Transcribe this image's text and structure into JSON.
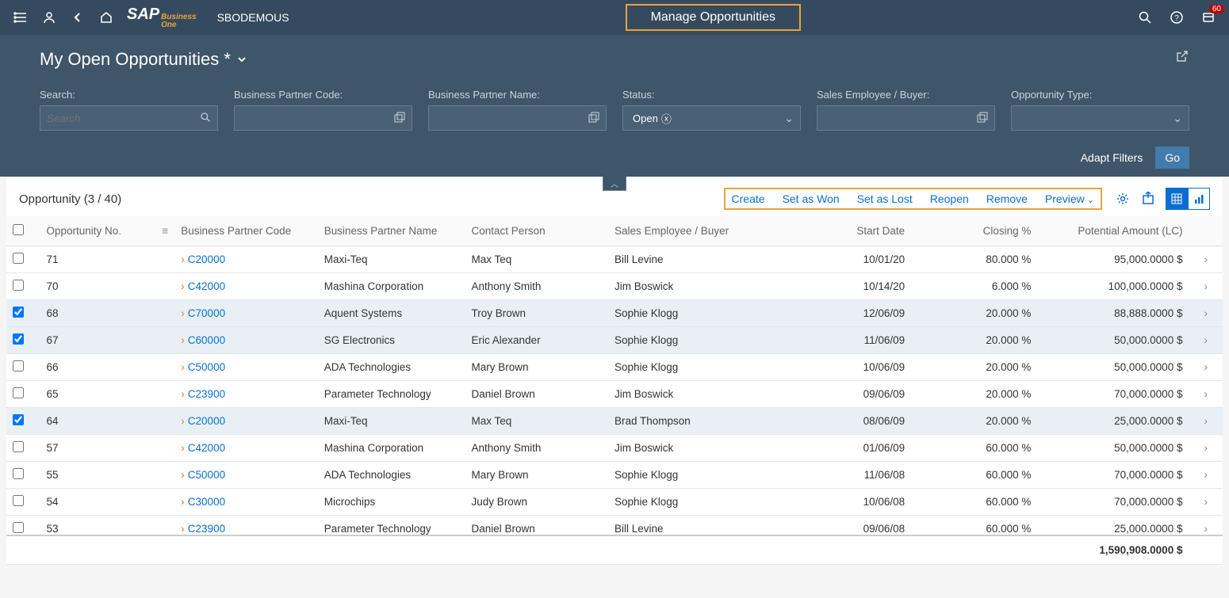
{
  "shell": {
    "tenant": "SBODEMOUS",
    "title": "Manage Opportunities",
    "notification_count": "60",
    "logo_main": "SAP",
    "logo_sub1": "Business",
    "logo_sub2": "One"
  },
  "page": {
    "view_title": "My Open Opportunities *",
    "share_glyph": "⇱"
  },
  "filters": {
    "search": {
      "label": "Search:",
      "placeholder": "Search"
    },
    "bp_code": {
      "label": "Business Partner Code:"
    },
    "bp_name": {
      "label": "Business Partner Name:"
    },
    "status": {
      "label": "Status:",
      "value": "Open"
    },
    "sales_emp": {
      "label": "Sales Employee / Buyer:"
    },
    "opp_type": {
      "label": "Opportunity Type:"
    },
    "adapt": "Adapt Filters",
    "go": "Go"
  },
  "table": {
    "title": "Opportunity (3 / 40)",
    "actions": {
      "create": "Create",
      "won": "Set as Won",
      "lost": "Set as Lost",
      "reopen": "Reopen",
      "remove": "Remove",
      "preview": "Preview"
    },
    "columns": {
      "opp_no": "Opportunity No.",
      "bp_code": "Business Partner Code",
      "bp_name": "Business Partner Name",
      "contact": "Contact Person",
      "sales_emp": "Sales Employee / Buyer",
      "start_date": "Start Date",
      "closing": "Closing %",
      "potential": "Potential Amount (LC)"
    },
    "rows": [
      {
        "sel": false,
        "no": "71",
        "bpc": "C20000",
        "bpn": "Maxi-Teq",
        "cp": "Max Teq",
        "se": "Bill Levine",
        "sd": "10/01/20",
        "cl": "80.000 %",
        "pa": "95,000.0000 $"
      },
      {
        "sel": false,
        "no": "70",
        "bpc": "C42000",
        "bpn": "Mashina Corporation",
        "cp": "Anthony Smith",
        "se": "Jim Boswick",
        "sd": "10/14/20",
        "cl": "6.000 %",
        "pa": "100,000.0000 $"
      },
      {
        "sel": true,
        "no": "68",
        "bpc": "C70000",
        "bpn": "Aquent Systems",
        "cp": "Troy Brown",
        "se": "Sophie Klogg",
        "sd": "12/06/09",
        "cl": "20.000 %",
        "pa": "88,888.0000 $"
      },
      {
        "sel": true,
        "no": "67",
        "bpc": "C60000",
        "bpn": "SG Electronics",
        "cp": "Eric Alexander",
        "se": "Sophie Klogg",
        "sd": "11/06/09",
        "cl": "20.000 %",
        "pa": "50,000.0000 $"
      },
      {
        "sel": false,
        "no": "66",
        "bpc": "C50000",
        "bpn": "ADA Technologies",
        "cp": "Mary Brown",
        "se": "Sophie Klogg",
        "sd": "10/06/09",
        "cl": "20.000 %",
        "pa": "50,000.0000 $"
      },
      {
        "sel": false,
        "no": "65",
        "bpc": "C23900",
        "bpn": "Parameter Technology",
        "cp": "Daniel Brown",
        "se": "Jim Boswick",
        "sd": "09/06/09",
        "cl": "20.000 %",
        "pa": "70,000.0000 $"
      },
      {
        "sel": true,
        "no": "64",
        "bpc": "C20000",
        "bpn": "Maxi-Teq",
        "cp": "Max Teq",
        "se": "Brad Thompson",
        "sd": "08/06/09",
        "cl": "20.000 %",
        "pa": "25,000.0000 $"
      },
      {
        "sel": false,
        "no": "57",
        "bpc": "C42000",
        "bpn": "Mashina Corporation",
        "cp": "Anthony Smith",
        "se": "Jim Boswick",
        "sd": "01/06/09",
        "cl": "60.000 %",
        "pa": "50,000.0000 $"
      },
      {
        "sel": false,
        "no": "55",
        "bpc": "C50000",
        "bpn": "ADA Technologies",
        "cp": "Mary Brown",
        "se": "Sophie Klogg",
        "sd": "11/06/08",
        "cl": "60.000 %",
        "pa": "70,000.0000 $"
      },
      {
        "sel": false,
        "no": "54",
        "bpc": "C30000",
        "bpn": "Microchips",
        "cp": "Judy Brown",
        "se": "Sophie Klogg",
        "sd": "10/06/08",
        "cl": "60.000 %",
        "pa": "70,000.0000 $"
      },
      {
        "sel": false,
        "no": "53",
        "bpc": "C23900",
        "bpn": "Parameter Technology",
        "cp": "Daniel Brown",
        "se": "Bill Levine",
        "sd": "09/06/08",
        "cl": "60.000 %",
        "pa": "25,000.0000 $"
      }
    ],
    "total": "1,590,908.0000 $"
  }
}
